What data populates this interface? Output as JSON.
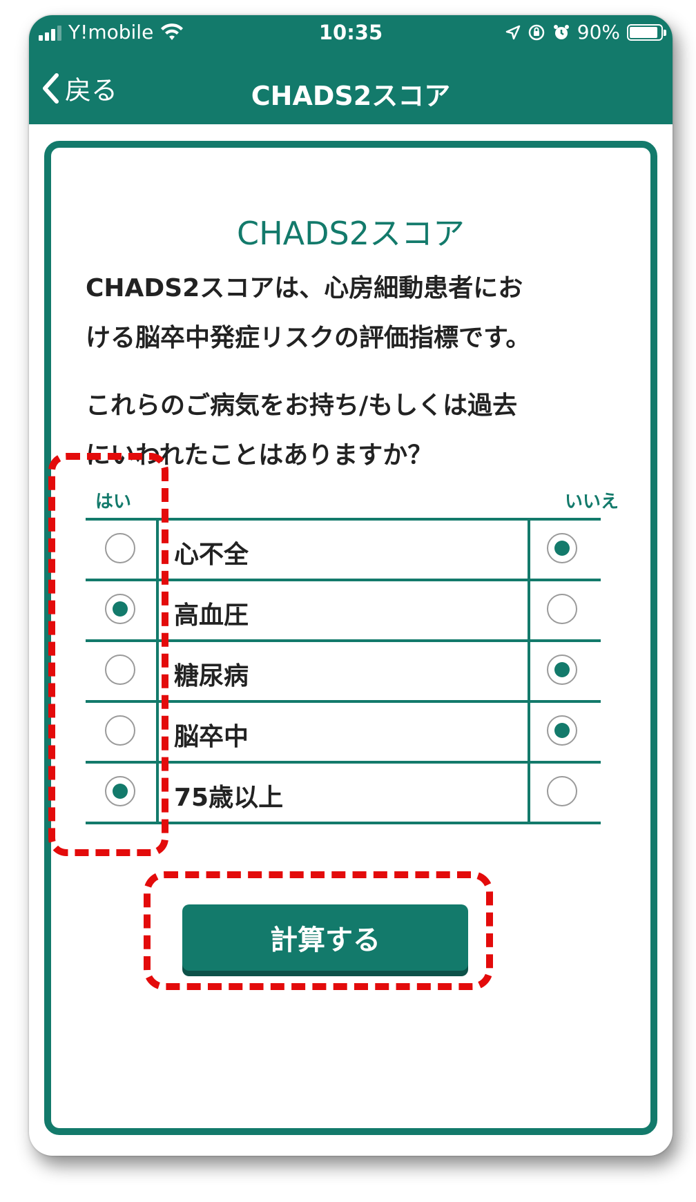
{
  "status_bar": {
    "carrier": "Y!mobile",
    "time": "10:35",
    "battery": "90%",
    "battery_level": 0.9
  },
  "nav": {
    "back_label": "戻る",
    "title": "CHADS2スコア"
  },
  "card": {
    "title": "CHADS2スコア",
    "description_lines": [
      "CHADS2スコアは、心房細動患者にお",
      "ける脳卒中発症リスクの評価指標です。"
    ],
    "question_lines": [
      "これらのご病気をお持ち/もしくは過去",
      "にいわれたことはありますか？"
    ]
  },
  "table": {
    "yes_header": "はい",
    "no_header": "いいえ",
    "rows": [
      {
        "label": "心不全",
        "answer": "no"
      },
      {
        "label": "高血圧",
        "answer": "yes"
      },
      {
        "label": "糖尿病",
        "answer": "no"
      },
      {
        "label": "脳卒中",
        "answer": "no"
      },
      {
        "label": "75歳以上",
        "answer": "yes"
      }
    ]
  },
  "calculate_button": "計算する",
  "colors": {
    "primary": "#137a6b",
    "highlight": "#e30b0b"
  }
}
